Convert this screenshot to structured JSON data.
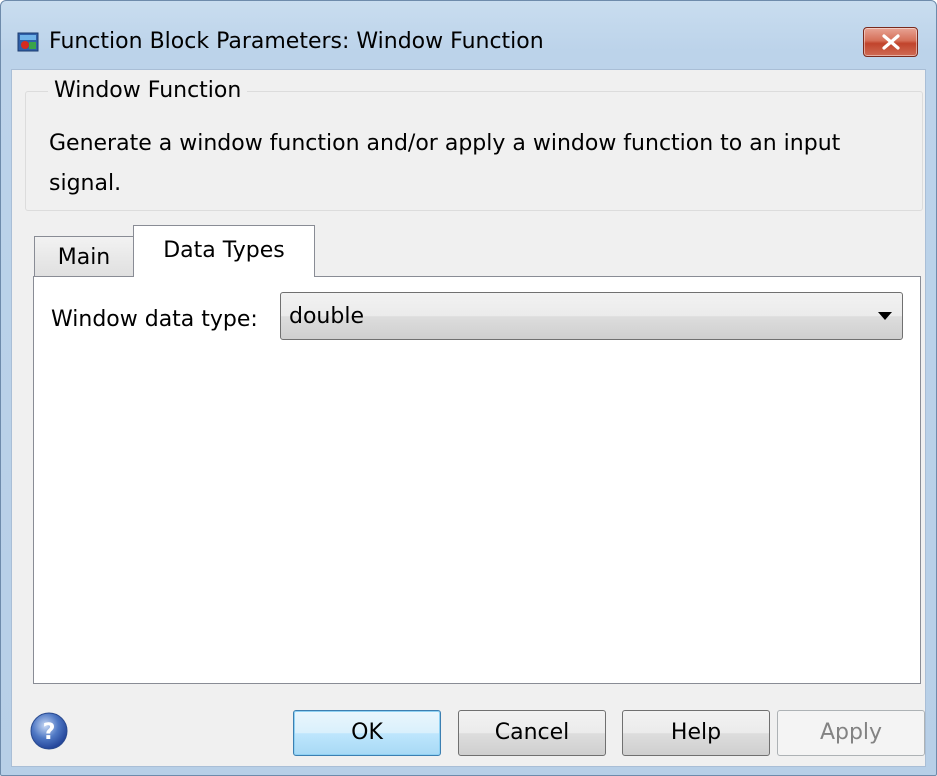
{
  "window": {
    "title": "Function Block Parameters: Window Function",
    "icon": "simulink-block-icon",
    "close_icon": "close-icon"
  },
  "group": {
    "title": "Window Function",
    "description": "Generate a window function and/or apply a window function to an input signal."
  },
  "tabs": [
    {
      "label": "Main",
      "selected": false
    },
    {
      "label": "Data Types",
      "selected": true
    }
  ],
  "fields": {
    "window_data_type": {
      "label": "Window data type:",
      "value": "double"
    }
  },
  "buttons": {
    "ok": "OK",
    "cancel": "Cancel",
    "help": "Help",
    "apply": "Apply",
    "apply_enabled": false
  },
  "help_icon": "help-circle-icon"
}
